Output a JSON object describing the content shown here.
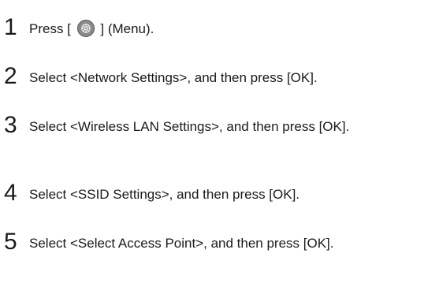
{
  "steps": [
    {
      "number": "1",
      "text_before": "Press [",
      "icon": "menu-gear-icon",
      "text_after": "] (Menu)."
    },
    {
      "number": "2",
      "text": "Select <Network Settings>, and then press [OK]."
    },
    {
      "number": "3",
      "text": "Select <Wireless LAN Settings>, and then press [OK]."
    },
    {
      "number": "4",
      "text": "Select <SSID Settings>, and then press [OK]."
    },
    {
      "number": "5",
      "text": "Select <Select Access Point>, and then press [OK]."
    }
  ]
}
